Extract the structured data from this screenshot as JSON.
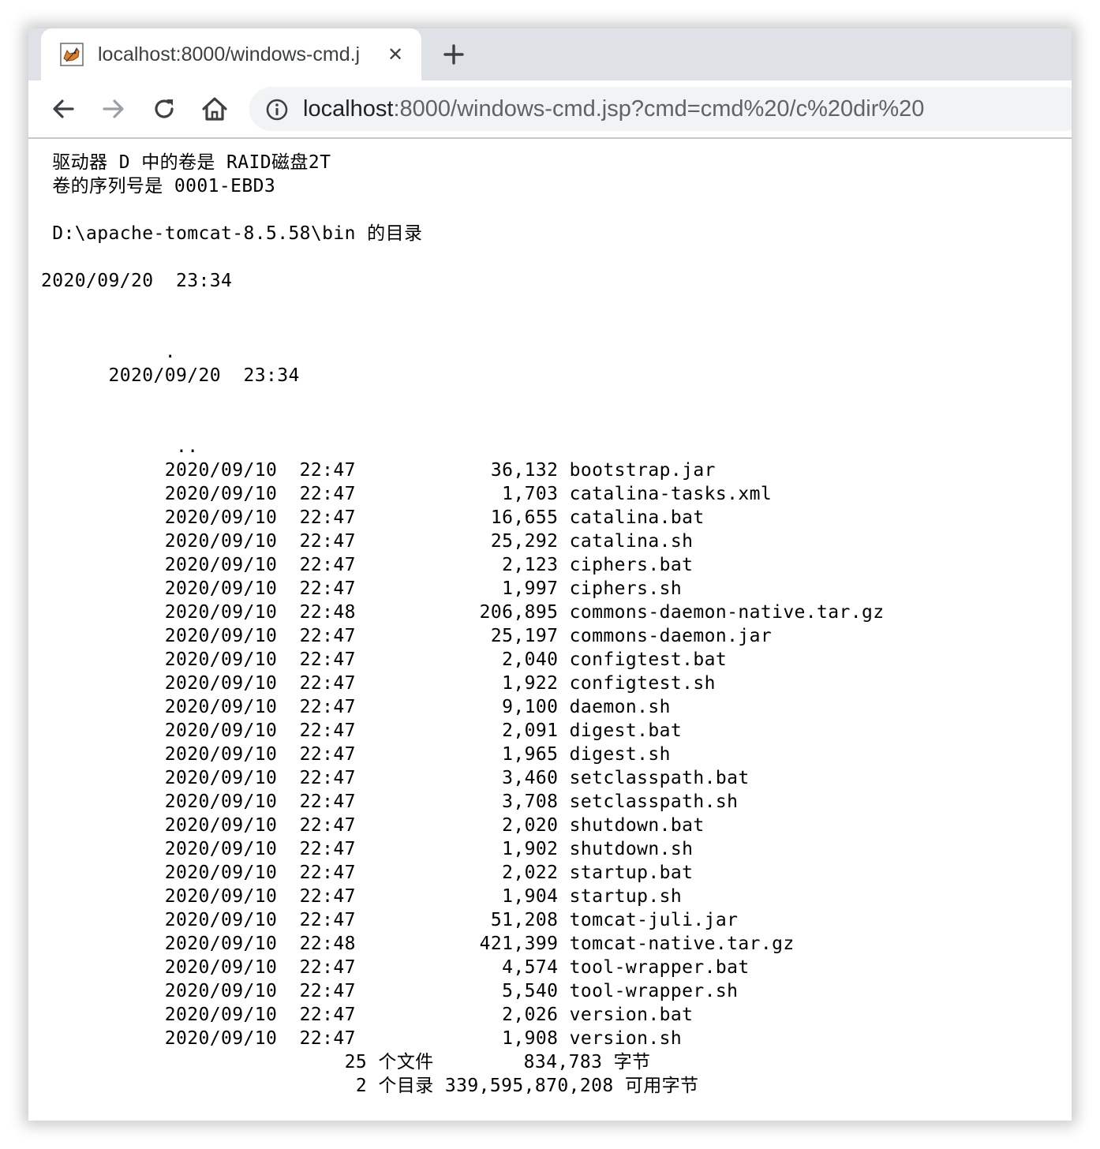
{
  "browser": {
    "tab": {
      "title": "localhost:8000/windows-cmd.j",
      "favicon": "tomcat-favicon-icon"
    },
    "address_bar": {
      "host": "localhost",
      "rest": ":8000/windows-cmd.jsp?cmd=cmd%20/c%20dir%20"
    }
  },
  "page": {
    "output": " 驱动器 D 中的卷是 RAID磁盘2T\n 卷的序列号是 0001-EBD3\n\n D:\\apache-tomcat-8.5.58\\bin 的目录\n\n2020/09/20  23:34\n\n\n           .\n      2020/09/20  23:34\n\n\n            ..\n           2020/09/10  22:47            36,132 bootstrap.jar\n           2020/09/10  22:47             1,703 catalina-tasks.xml\n           2020/09/10  22:47            16,655 catalina.bat\n           2020/09/10  22:47            25,292 catalina.sh\n           2020/09/10  22:47             2,123 ciphers.bat\n           2020/09/10  22:47             1,997 ciphers.sh\n           2020/09/10  22:48           206,895 commons-daemon-native.tar.gz\n           2020/09/10  22:47            25,197 commons-daemon.jar\n           2020/09/10  22:47             2,040 configtest.bat\n           2020/09/10  22:47             1,922 configtest.sh\n           2020/09/10  22:47             9,100 daemon.sh\n           2020/09/10  22:47             2,091 digest.bat\n           2020/09/10  22:47             1,965 digest.sh\n           2020/09/10  22:47             3,460 setclasspath.bat\n           2020/09/10  22:47             3,708 setclasspath.sh\n           2020/09/10  22:47             2,020 shutdown.bat\n           2020/09/10  22:47             1,902 shutdown.sh\n           2020/09/10  22:47             2,022 startup.bat\n           2020/09/10  22:47             1,904 startup.sh\n           2020/09/10  22:47            51,208 tomcat-juli.jar\n           2020/09/10  22:48           421,399 tomcat-native.tar.gz\n           2020/09/10  22:47             4,574 tool-wrapper.bat\n           2020/09/10  22:47             5,540 tool-wrapper.sh\n           2020/09/10  22:47             2,026 version.bat\n           2020/09/10  22:47             1,908 version.sh\n                           25 个文件        834,783 字节\n                            2 个目录 339,595,870,208 可用字节"
  },
  "colors": {
    "tabbar_bg": "#dee1e6",
    "omnibox_bg": "#f1f3f4",
    "icon_color": "#5f6368",
    "text_color": "#000000"
  }
}
